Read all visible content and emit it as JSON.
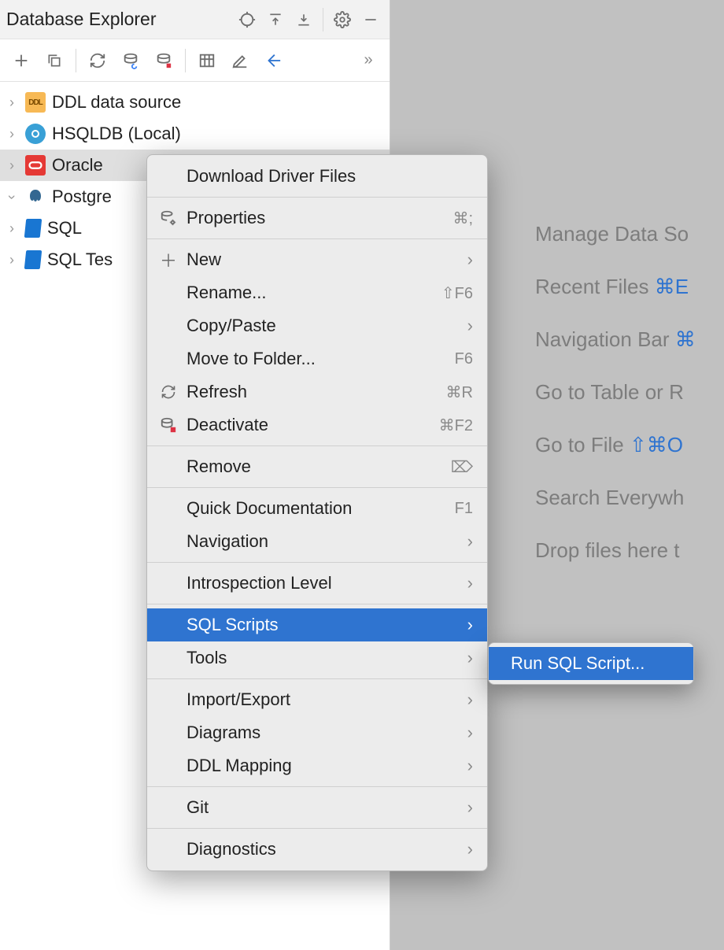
{
  "panel": {
    "title": "Database Explorer"
  },
  "tree": {
    "items": [
      {
        "label": "DDL data source"
      },
      {
        "label": "HSQLDB (Local)"
      },
      {
        "label": "Oracle"
      },
      {
        "label": "Postgre"
      },
      {
        "label": "SQL"
      },
      {
        "label": "SQL Tes"
      }
    ]
  },
  "context_menu": {
    "download_driver": "Download Driver Files",
    "properties": {
      "label": "Properties",
      "shortcut": "⌘;"
    },
    "new": "New",
    "rename": {
      "label": "Rename...",
      "shortcut": "⇧F6"
    },
    "copy_paste": "Copy/Paste",
    "move_to_folder": {
      "label": "Move to Folder...",
      "shortcut": "F6"
    },
    "refresh": {
      "label": "Refresh",
      "shortcut": "⌘R"
    },
    "deactivate": {
      "label": "Deactivate",
      "shortcut": "⌘F2"
    },
    "remove": {
      "label": "Remove",
      "shortcut": "⌦"
    },
    "quick_doc": {
      "label": "Quick Documentation",
      "shortcut": "F1"
    },
    "navigation": "Navigation",
    "introspection": "Introspection Level",
    "sql_scripts": "SQL Scripts",
    "tools": "Tools",
    "import_export": "Import/Export",
    "diagrams": "Diagrams",
    "ddl_mapping": "DDL Mapping",
    "git": "Git",
    "diagnostics": "Diagnostics"
  },
  "submenu": {
    "run_sql": "Run SQL Script..."
  },
  "welcome": {
    "manage_ds": "Manage Data So",
    "recent_files": {
      "label": "Recent Files ",
      "k": "⌘E"
    },
    "nav_bar": {
      "label": "Navigation Bar ",
      "k": "⌘"
    },
    "goto_table": "Go to Table or R",
    "goto_file": {
      "label": "Go to File ",
      "k": "⇧⌘O"
    },
    "search_everywhere": "Search Everywh",
    "drop_files": "Drop files here t"
  }
}
